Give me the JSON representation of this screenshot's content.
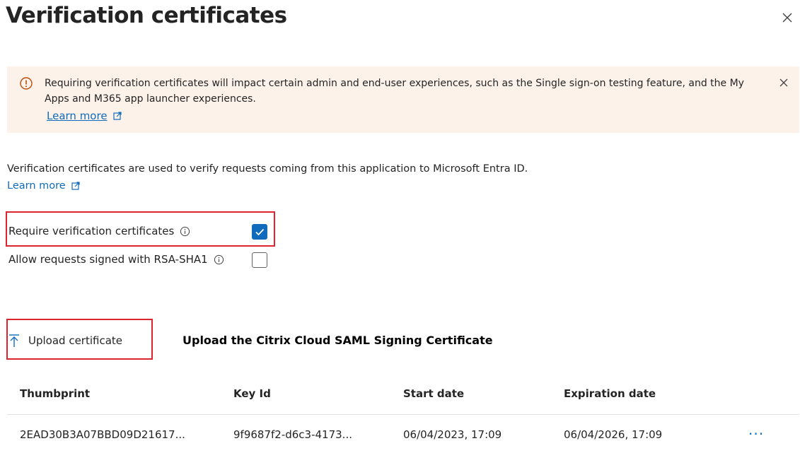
{
  "panel": {
    "title": "Verification certificates",
    "close_label": "Close"
  },
  "banner": {
    "message": "Requiring verification certificates will impact certain admin and end-user experiences, such as the Single sign-on testing feature, and the My Apps and M365 app launcher experiences.",
    "link_label": "Learn more",
    "type": "warning",
    "background_color": "#fdf2ea",
    "icon_color": "#bc4b09"
  },
  "description": {
    "text": "Verification certificates are used to verify requests coming from this application to Microsoft Entra ID.",
    "link_label": "Learn more"
  },
  "options": [
    {
      "label": "Require verification certificates",
      "checked": true
    },
    {
      "label": "Allow requests signed with RSA-SHA1",
      "checked": false
    }
  ],
  "upload": {
    "button_label": "Upload certificate",
    "annotation": "Upload the Citrix Cloud SAML Signing Certificate"
  },
  "table": {
    "columns": [
      "Thumbprint",
      "Key Id",
      "Start date",
      "Expiration date"
    ],
    "rows": [
      [
        "2EAD30B3A07BBD09D21617...",
        "9f9687f2-d6c3-4173...",
        "06/04/2023, 17:09",
        "06/04/2026, 17:09"
      ]
    ],
    "row_menu_label": "···"
  },
  "colors": {
    "accent": "#0f6cbd",
    "highlight_box": "#e0242f",
    "text": "#242424"
  }
}
